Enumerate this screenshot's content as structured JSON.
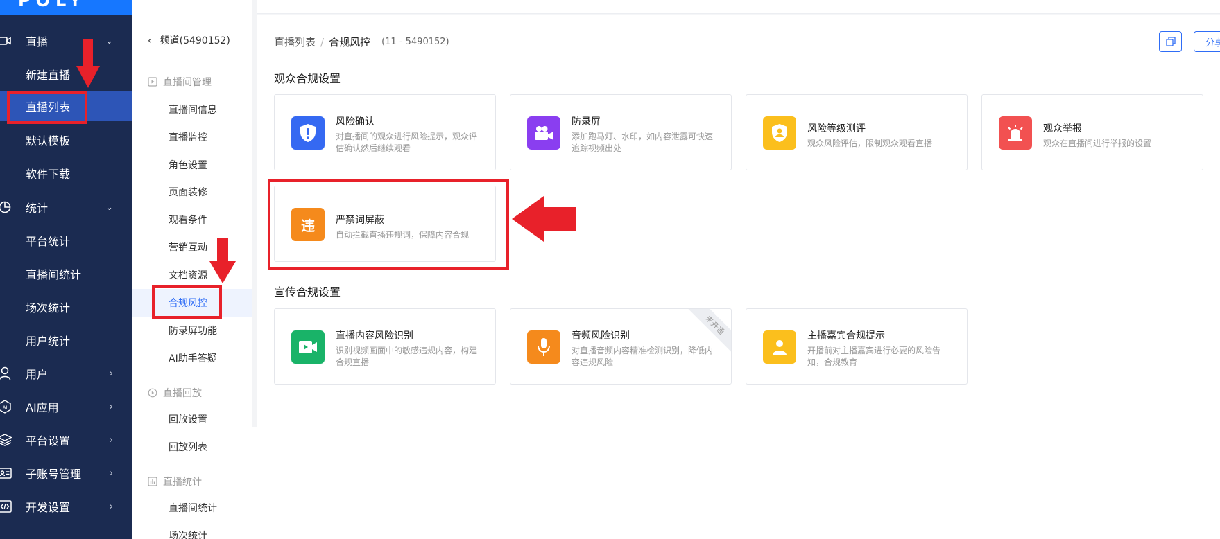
{
  "logo_text": "POLY",
  "sidebar": {
    "items": [
      {
        "label": "直播",
        "icon": "video-icon",
        "chev": "⌄"
      },
      {
        "label": "新建直播"
      },
      {
        "label": "直播列表"
      },
      {
        "label": "默认模板"
      },
      {
        "label": "软件下载"
      },
      {
        "label": "统计",
        "icon": "pie-chart-icon",
        "chev": "⌄"
      },
      {
        "label": "平台统计"
      },
      {
        "label": "直播间统计"
      },
      {
        "label": "场次统计"
      },
      {
        "label": "用户统计"
      },
      {
        "label": "用户",
        "icon": "user-icon",
        "chev": "›"
      },
      {
        "label": "AI应用",
        "icon": "ai-icon",
        "chev": "›"
      },
      {
        "label": "平台设置",
        "icon": "layers-icon",
        "chev": "›"
      },
      {
        "label": "子账号管理",
        "icon": "id-card-icon",
        "chev": "›"
      },
      {
        "label": "开发设置",
        "icon": "code-icon",
        "chev": "›"
      }
    ]
  },
  "subnav": {
    "back_label": "频道(5490152)",
    "groups": [
      {
        "label": "直播间管理",
        "icon": "play-square-icon"
      },
      {
        "label": "直播回放",
        "icon": "replay-icon"
      },
      {
        "label": "直播统计",
        "icon": "bar-chart-icon"
      }
    ],
    "items": [
      "直播间信息",
      "直播监控",
      "角色设置",
      "页面装修",
      "观看条件",
      "营销互动",
      "文档资源",
      "合规风控",
      "防录屏功能",
      "AI助手答疑",
      "回放设置",
      "回放列表",
      "直播间统计",
      "场次统计"
    ]
  },
  "breadcrumb": {
    "parent": "直播列表",
    "sep": "/",
    "current": "合规风控",
    "id": "(11 - 5490152)"
  },
  "toolbar": {
    "share_label": "分享"
  },
  "sections": {
    "audience": {
      "title": "观众合规设置",
      "cards": [
        {
          "title": "风险确认",
          "desc": "对直播间的观众进行风险提示，观众评估确认然后继续观看",
          "color": "#3569f2",
          "icon": "shield-alert-icon"
        },
        {
          "title": "防录屏",
          "desc": "添加跑马灯、水印，如内容泄露可快速追踪视频出处",
          "color": "#8a3ef0",
          "icon": "video-camera-icon"
        },
        {
          "title": "风险等级测评",
          "desc": "观众风险评估，限制观众观看直播",
          "color": "#fbbf1d",
          "icon": "shield-user-icon"
        },
        {
          "title": "观众举报",
          "desc": "观众在直播间进行举报的设置",
          "color": "#f25151",
          "icon": "alarm-icon"
        },
        {
          "title": "严禁词屏蔽",
          "desc": "自动拦截直播违规词，保障内容合规",
          "color": "#f58a1c",
          "icon": "forbidden-word-icon",
          "glyph": "违"
        }
      ]
    },
    "promo": {
      "title": "宣传合规设置",
      "cards": [
        {
          "title": "直播内容风险识别",
          "desc": "识别视频画面中的敏感违规内容，构建合规直播",
          "color": "#19b368",
          "icon": "video-scan-icon"
        },
        {
          "title": "音频风险识别",
          "desc": "对直播音频内容精准检测识别，降低内容违规风险",
          "color": "#f58a1c",
          "icon": "microphone-icon",
          "ribbon": "未开通"
        },
        {
          "title": "主播嘉宾合规提示",
          "desc": "开播前对主播嘉宾进行必要的风险告知，合规教育",
          "color": "#fbbf1d",
          "icon": "presenter-icon"
        }
      ]
    }
  }
}
